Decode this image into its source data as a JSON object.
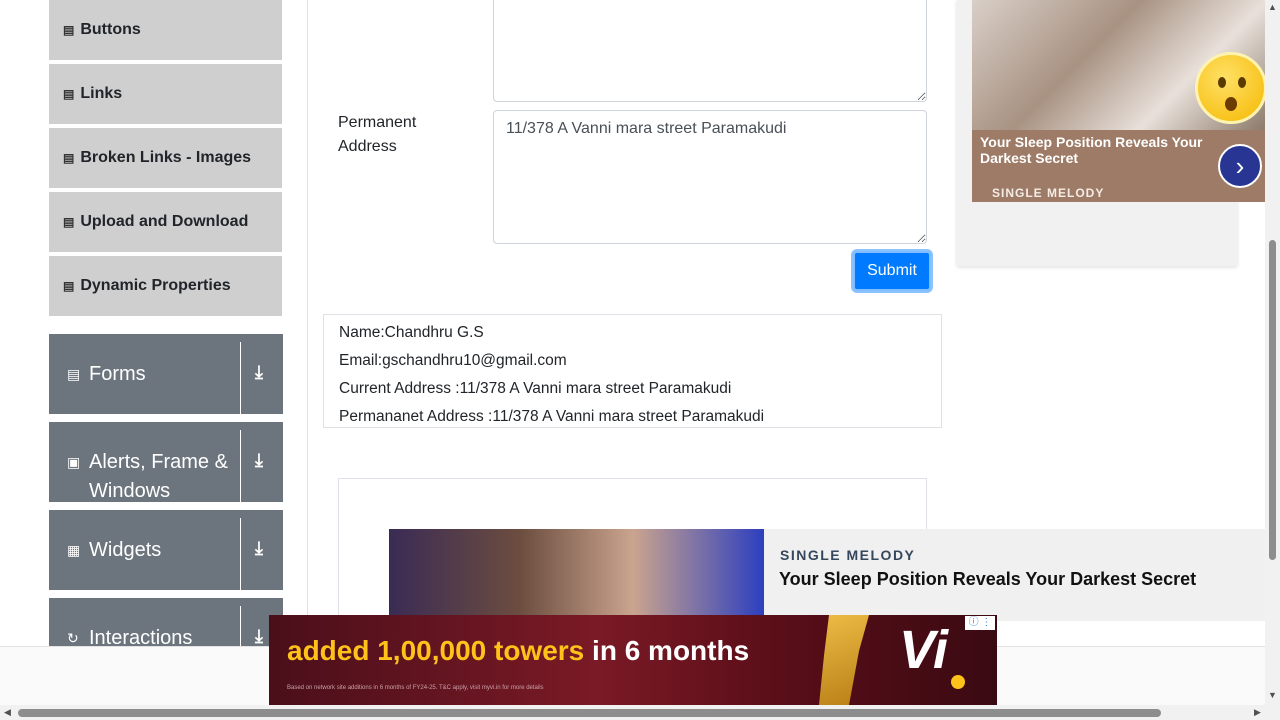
{
  "sidebar": {
    "sub_items": [
      {
        "label": "Buttons"
      },
      {
        "label": "Links"
      },
      {
        "label": "Broken Links - Images"
      },
      {
        "label": "Upload and Download"
      },
      {
        "label": "Dynamic Properties"
      }
    ],
    "groups": [
      {
        "label": "Forms",
        "icon": "form-icon"
      },
      {
        "label": "Alerts, Frame & Windows",
        "icon": "window-icon"
      },
      {
        "label": "Widgets",
        "icon": "widgets-icon"
      },
      {
        "label": "Interactions",
        "icon": "interactions-icon"
      }
    ]
  },
  "form": {
    "permanent_address_label": "Permanent Address",
    "permanent_address_value": "11/378 A Vanni mara street Paramakudi",
    "submit_label": "Submit"
  },
  "output": {
    "name": "Name:Chandhru G.S",
    "email": "Email:gschandhru10@gmail.com",
    "current_address": "Current Address :11/378 A Vanni mara street Paramakudi",
    "permanent_address": "Permananet Address :11/378 A Vanni mara street Paramakudi"
  },
  "right_ad": {
    "title": "Your Sleep Position Reveals Your Darkest Secret",
    "brand": "SINGLE MELODY"
  },
  "bottom_ad": {
    "brand": "SINGLE MELODY",
    "title": "Your Sleep Position Reveals Your Darkest Secret"
  },
  "vi_ad": {
    "headline_highlight": "added 1,00,000 towers",
    "headline_rest": " in 6 months",
    "fine_print": "Based on network site additions in 6 months of FY24-25. T&C apply, visit myvi.in for more details",
    "logo": "Vi"
  }
}
